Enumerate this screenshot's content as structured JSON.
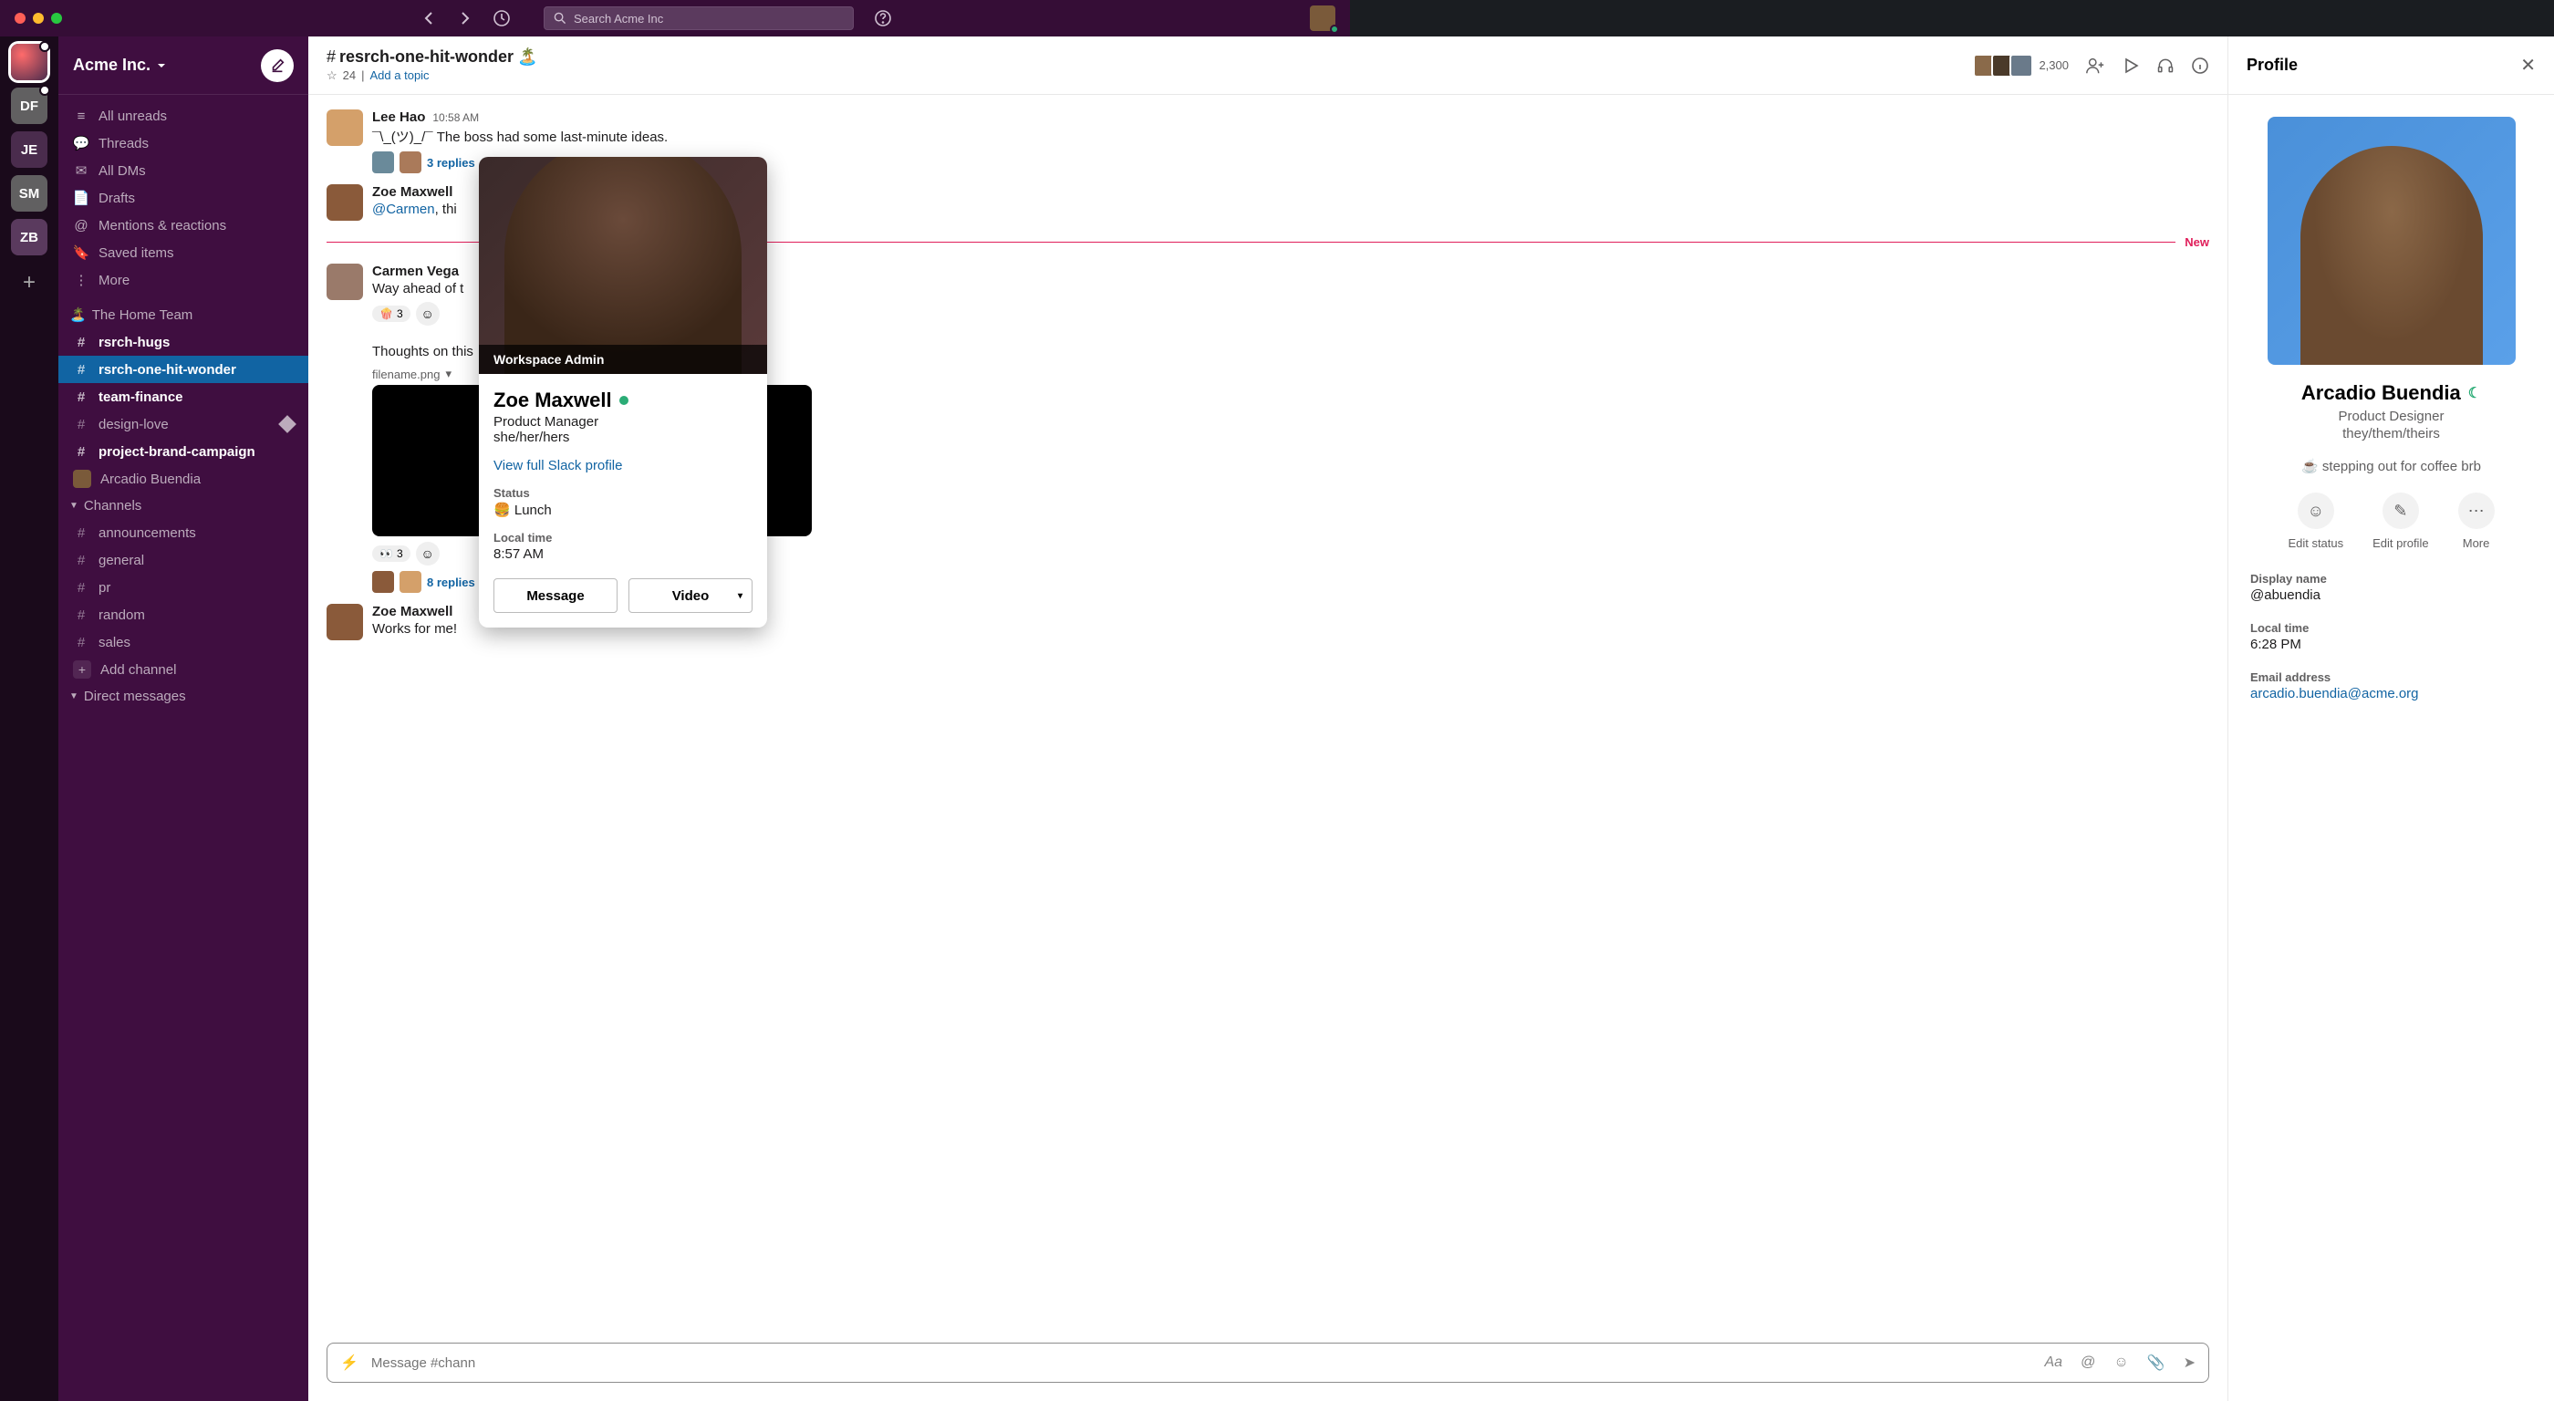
{
  "titlebar": {
    "search_placeholder": "Search Acme Inc"
  },
  "workspaces": [
    {
      "initials": "",
      "active": true,
      "has_badge": true
    },
    {
      "initials": "DF",
      "bg": "#616061"
    },
    {
      "initials": "JE",
      "bg": "#4a2c4d"
    },
    {
      "initials": "SM",
      "bg": "#616061"
    },
    {
      "initials": "ZB",
      "bg": "#5a3a5e"
    }
  ],
  "sidebar": {
    "workspace_name": "Acme Inc.",
    "nav": [
      {
        "label": "All unreads",
        "icon": "≡"
      },
      {
        "label": "Threads",
        "icon": "💬"
      },
      {
        "label": "All DMs",
        "icon": "✉"
      },
      {
        "label": "Drafts",
        "icon": "📄"
      },
      {
        "label": "Mentions & reactions",
        "icon": "@"
      },
      {
        "label": "Saved items",
        "icon": "🔖"
      },
      {
        "label": "More",
        "icon": "⋮"
      }
    ],
    "starred_section": {
      "label": "The Home Team",
      "icon": "🏝️"
    },
    "starred": [
      {
        "label": "rsrch-hugs",
        "bold": true
      },
      {
        "label": "rsrch-one-hit-wonder",
        "bold": true,
        "active": true
      },
      {
        "label": "team-finance",
        "bold": true
      },
      {
        "label": "design-love",
        "trailing": "diamond"
      },
      {
        "label": "project-brand-campaign",
        "bold": true
      },
      {
        "label": "Arcadio Buendia",
        "dm": true
      }
    ],
    "channels_header": "Channels",
    "channels": [
      {
        "label": "announcements"
      },
      {
        "label": "general"
      },
      {
        "label": "pr"
      },
      {
        "label": "random"
      },
      {
        "label": "sales"
      }
    ],
    "add_channel": "Add channel",
    "dm_header": "Direct messages"
  },
  "channel": {
    "name": "resrch-one-hit-wonder",
    "emoji": "🏝️",
    "pins": "24",
    "topic_prompt": "Add a topic",
    "member_count": "2,300"
  },
  "messages": [
    {
      "author": "Lee Hao",
      "time": "10:58 AM",
      "text": "¯\\_(ツ)_/¯ The boss had some last-minute ideas.",
      "replies": "3 replies"
    },
    {
      "author": "Zoe Maxwell",
      "mention": "@Carmen",
      "text_suffix": ", thi"
    },
    {
      "author": "Carmen Vega",
      "text": "Way ahead of t",
      "reaction_emoji": "🍿",
      "reaction_count": "3"
    },
    {
      "text_only": "Thoughts on this",
      "filename": "filename.png",
      "viewers_emoji": "👀",
      "viewers_count": "3",
      "replies": "8 replies"
    },
    {
      "author": "Zoe Maxwell",
      "text": "Works for me!"
    }
  ],
  "new_divider": "New",
  "composer": {
    "placeholder": "Message #chann"
  },
  "hover_card": {
    "badge": "Workspace Admin",
    "name": "Zoe Maxwell",
    "role": "Product Manager",
    "pronouns": "she/her/hers",
    "profile_link": "View full Slack profile",
    "status_label": "Status",
    "status_emoji": "🍔",
    "status_text": "Lunch",
    "local_time_label": "Local time",
    "local_time": "8:57 AM",
    "message_btn": "Message",
    "video_btn": "Video"
  },
  "profile": {
    "title": "Profile",
    "name": "Arcadio Buendia",
    "role": "Product Designer",
    "pronouns": "they/them/theirs",
    "status": "☕ stepping out for coffee brb",
    "actions": {
      "edit_status": "Edit status",
      "edit_profile": "Edit profile",
      "more": "More"
    },
    "fields": {
      "display_name_label": "Display name",
      "display_name": "@abuendia",
      "local_time_label": "Local time",
      "local_time": "6:28 PM",
      "email_label": "Email address",
      "email": "arcadio.buendia@acme.org"
    }
  }
}
